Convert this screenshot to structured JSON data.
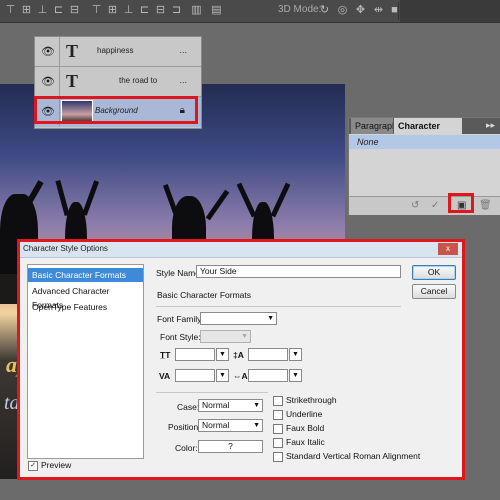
{
  "toolbar": {
    "mode_label": "3D Mode:"
  },
  "layers": [
    {
      "name": "happiness",
      "type": "text",
      "menu": "..."
    },
    {
      "name": "the road to",
      "type": "text",
      "menu": "..."
    },
    {
      "name": "Background",
      "type": "image"
    }
  ],
  "character_panel": {
    "tabs": [
      "Paragraph",
      "Character Styles"
    ],
    "menu_icon": "▸▸",
    "styles": [
      "None"
    ]
  },
  "dialog": {
    "title": "Character Style Options",
    "close": "x",
    "sections": [
      "Basic Character Formats",
      "Advanced Character Formats",
      "OpenType Features"
    ],
    "preview_label": "Preview",
    "style_name_label": "Style Name:",
    "style_name_value": "Your Side",
    "section_heading": "Basic Character Formats",
    "font_family_label": "Font Family:",
    "font_style_label": "Font Style:",
    "case_label": "Case:",
    "case_value": "Normal",
    "position_label": "Position:",
    "position_value": "Normal",
    "color_label": "Color:",
    "color_value": "?",
    "ok_label": "OK",
    "cancel_label": "Cancel",
    "checkboxes": [
      "Strikethrough",
      "Underline",
      "Faux Bold",
      "Faux Italic",
      "Standard Vertical Roman Alignment"
    ]
  },
  "canvas_text": {
    "gold": "ap",
    "silver": "ta"
  },
  "colors": {
    "highlight": "#e0161d",
    "selection": "#3e89d8"
  }
}
